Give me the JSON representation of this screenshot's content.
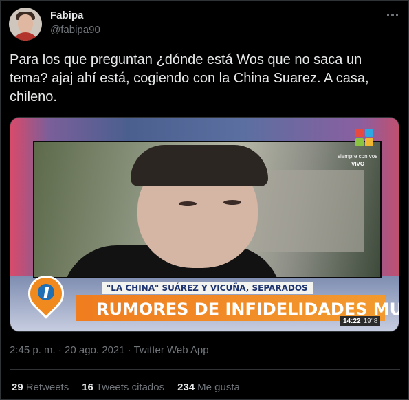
{
  "author": {
    "name": "Fabipa",
    "handle": "@fabipa90"
  },
  "tweet": {
    "text": "Para los que preguntan ¿dónde está Wos que no saca un tema? ajaj ahí está, cogiendo con la China Suarez. A casa, chileno."
  },
  "media": {
    "channel_tagline": "siempre con vos",
    "live_label": "VIVO",
    "headline_small": "\"LA CHINA\" SUÁREZ Y VICUÑA, SEPARADOS",
    "headline_main": "RUMORES DE INFIDELIDADES MUTUAS",
    "clock_time": "14:22",
    "clock_temp": "19°8"
  },
  "meta": {
    "timestamp": "2:45 p. m. · 20 ago. 2021 · Twitter Web App"
  },
  "stats": [
    {
      "count": "29",
      "label": "Retweets"
    },
    {
      "count": "16",
      "label": "Tweets citados"
    },
    {
      "count": "234",
      "label": "Me gusta"
    }
  ],
  "colors": {
    "background": "#000000",
    "text_primary": "#e7e9ea",
    "text_secondary": "#71767b",
    "border": "#2f3336",
    "banner_orange": "#f07d1f"
  },
  "icons": {
    "more": "more-options-icon"
  }
}
